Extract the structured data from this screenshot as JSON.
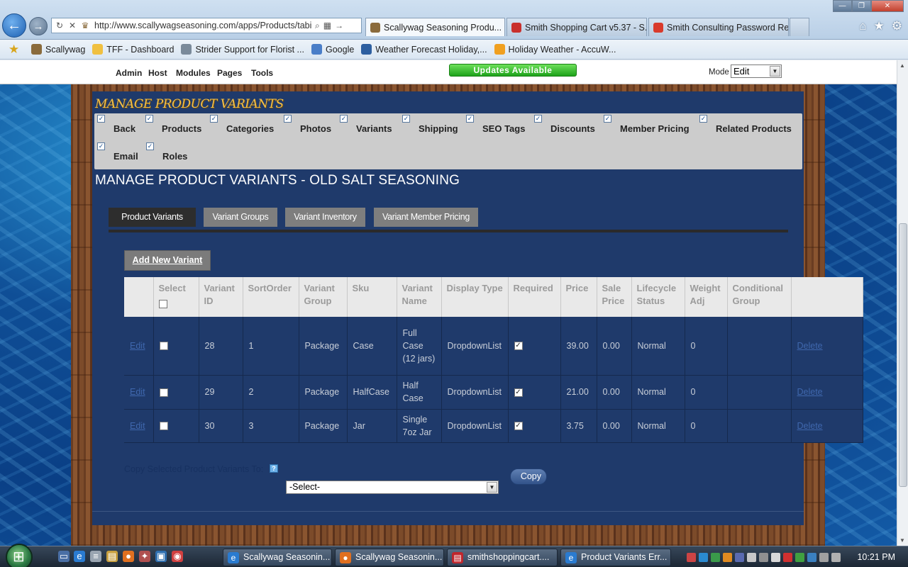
{
  "browser": {
    "address": "http://www.scallywagseasoning.com/apps/Products/tabic",
    "tabs": [
      {
        "title": "Scallywag Seasoning Produ...",
        "active": true
      },
      {
        "title": "Smith Shopping Cart v5.37 - S...",
        "active": false
      },
      {
        "title": "Smith Consulting Password Re...",
        "active": false
      }
    ],
    "favorites": [
      {
        "label": "Scallywag"
      },
      {
        "label": "TFF - Dashboard"
      },
      {
        "label": "Strider Support for Florist ..."
      },
      {
        "label": "Google"
      },
      {
        "label": "Weather Forecast Holiday,..."
      },
      {
        "label": "Holiday Weather - AccuW..."
      }
    ]
  },
  "control_bar": {
    "menu": [
      "Admin",
      "Host",
      "Modules",
      "Pages",
      "Tools"
    ],
    "updates": "Updates Available",
    "mode_label": "Mode",
    "mode_value": "Edit"
  },
  "module": {
    "title": "MANAGE PRODUCT VARIANTS",
    "action_menu": [
      "Back",
      "Products",
      "Categories",
      "Photos",
      "Variants",
      "Shipping",
      "SEO Tags",
      "Discounts",
      "Member Pricing",
      "Related Products",
      "Email",
      "Roles"
    ],
    "heading": "MANAGE PRODUCT VARIANTS - OLD SALT SEASONING",
    "sub_tabs": [
      {
        "label": "Product Variants",
        "selected": true
      },
      {
        "label": "Variant Groups",
        "selected": false
      },
      {
        "label": "Variant Inventory",
        "selected": false
      },
      {
        "label": "Variant Member Pricing",
        "selected": false
      }
    ],
    "add_button": "Add New Variant",
    "table": {
      "headers": [
        "",
        "Select",
        "Variant ID",
        "SortOrder",
        "Variant Group",
        "Sku",
        "Variant Name",
        "Display Type",
        "Required",
        "Price",
        "Sale Price",
        "Lifecycle Status",
        "Weight Adj",
        "Conditional Group",
        ""
      ],
      "rows": [
        {
          "edit": "Edit",
          "variant_id": "28",
          "sort_order": "1",
          "group": "Package",
          "sku": "Case",
          "name": "Full Case (12 jars)",
          "display_type": "DropdownList",
          "required": true,
          "price": "39.00",
          "sale_price": "0.00",
          "lifecycle": "Normal",
          "weight_adj": "0",
          "conditional_group": "",
          "delete": "Delete"
        },
        {
          "edit": "Edit",
          "variant_id": "29",
          "sort_order": "2",
          "group": "Package",
          "sku": "HalfCase",
          "name": "Half Case",
          "display_type": "DropdownList",
          "required": true,
          "price": "21.00",
          "sale_price": "0.00",
          "lifecycle": "Normal",
          "weight_adj": "0",
          "conditional_group": "",
          "delete": "Delete"
        },
        {
          "edit": "Edit",
          "variant_id": "30",
          "sort_order": "3",
          "group": "Package",
          "sku": "Jar",
          "name": "Single 7oz Jar",
          "display_type": "DropdownList",
          "required": true,
          "price": "3.75",
          "sale_price": "0.00",
          "lifecycle": "Normal",
          "weight_adj": "0",
          "conditional_group": "",
          "delete": "Delete"
        }
      ]
    },
    "copy_label": "Copy Selected Product Variants To:",
    "copy_select": "-Select-",
    "copy_button": "Copy"
  },
  "taskbar": {
    "buttons": [
      "Scallywag Seasonin...",
      "Scallywag Seasonin...",
      "smithshoppingcart....",
      "Product Variants Err..."
    ],
    "clock": "10:21 PM"
  },
  "icons": {
    "back": "back-arrow-icon",
    "forward": "forward-arrow-icon",
    "home": "home-icon",
    "favorites": "star-icon",
    "tools": "gear-icon",
    "help": "help-icon"
  },
  "colors": {
    "module_bg": "#1f3a6b",
    "module_title": "#f4c14a",
    "updates_green": "#1ea21a",
    "selected_tab": "#2d2d2d",
    "tab": "#7e7e7e"
  }
}
